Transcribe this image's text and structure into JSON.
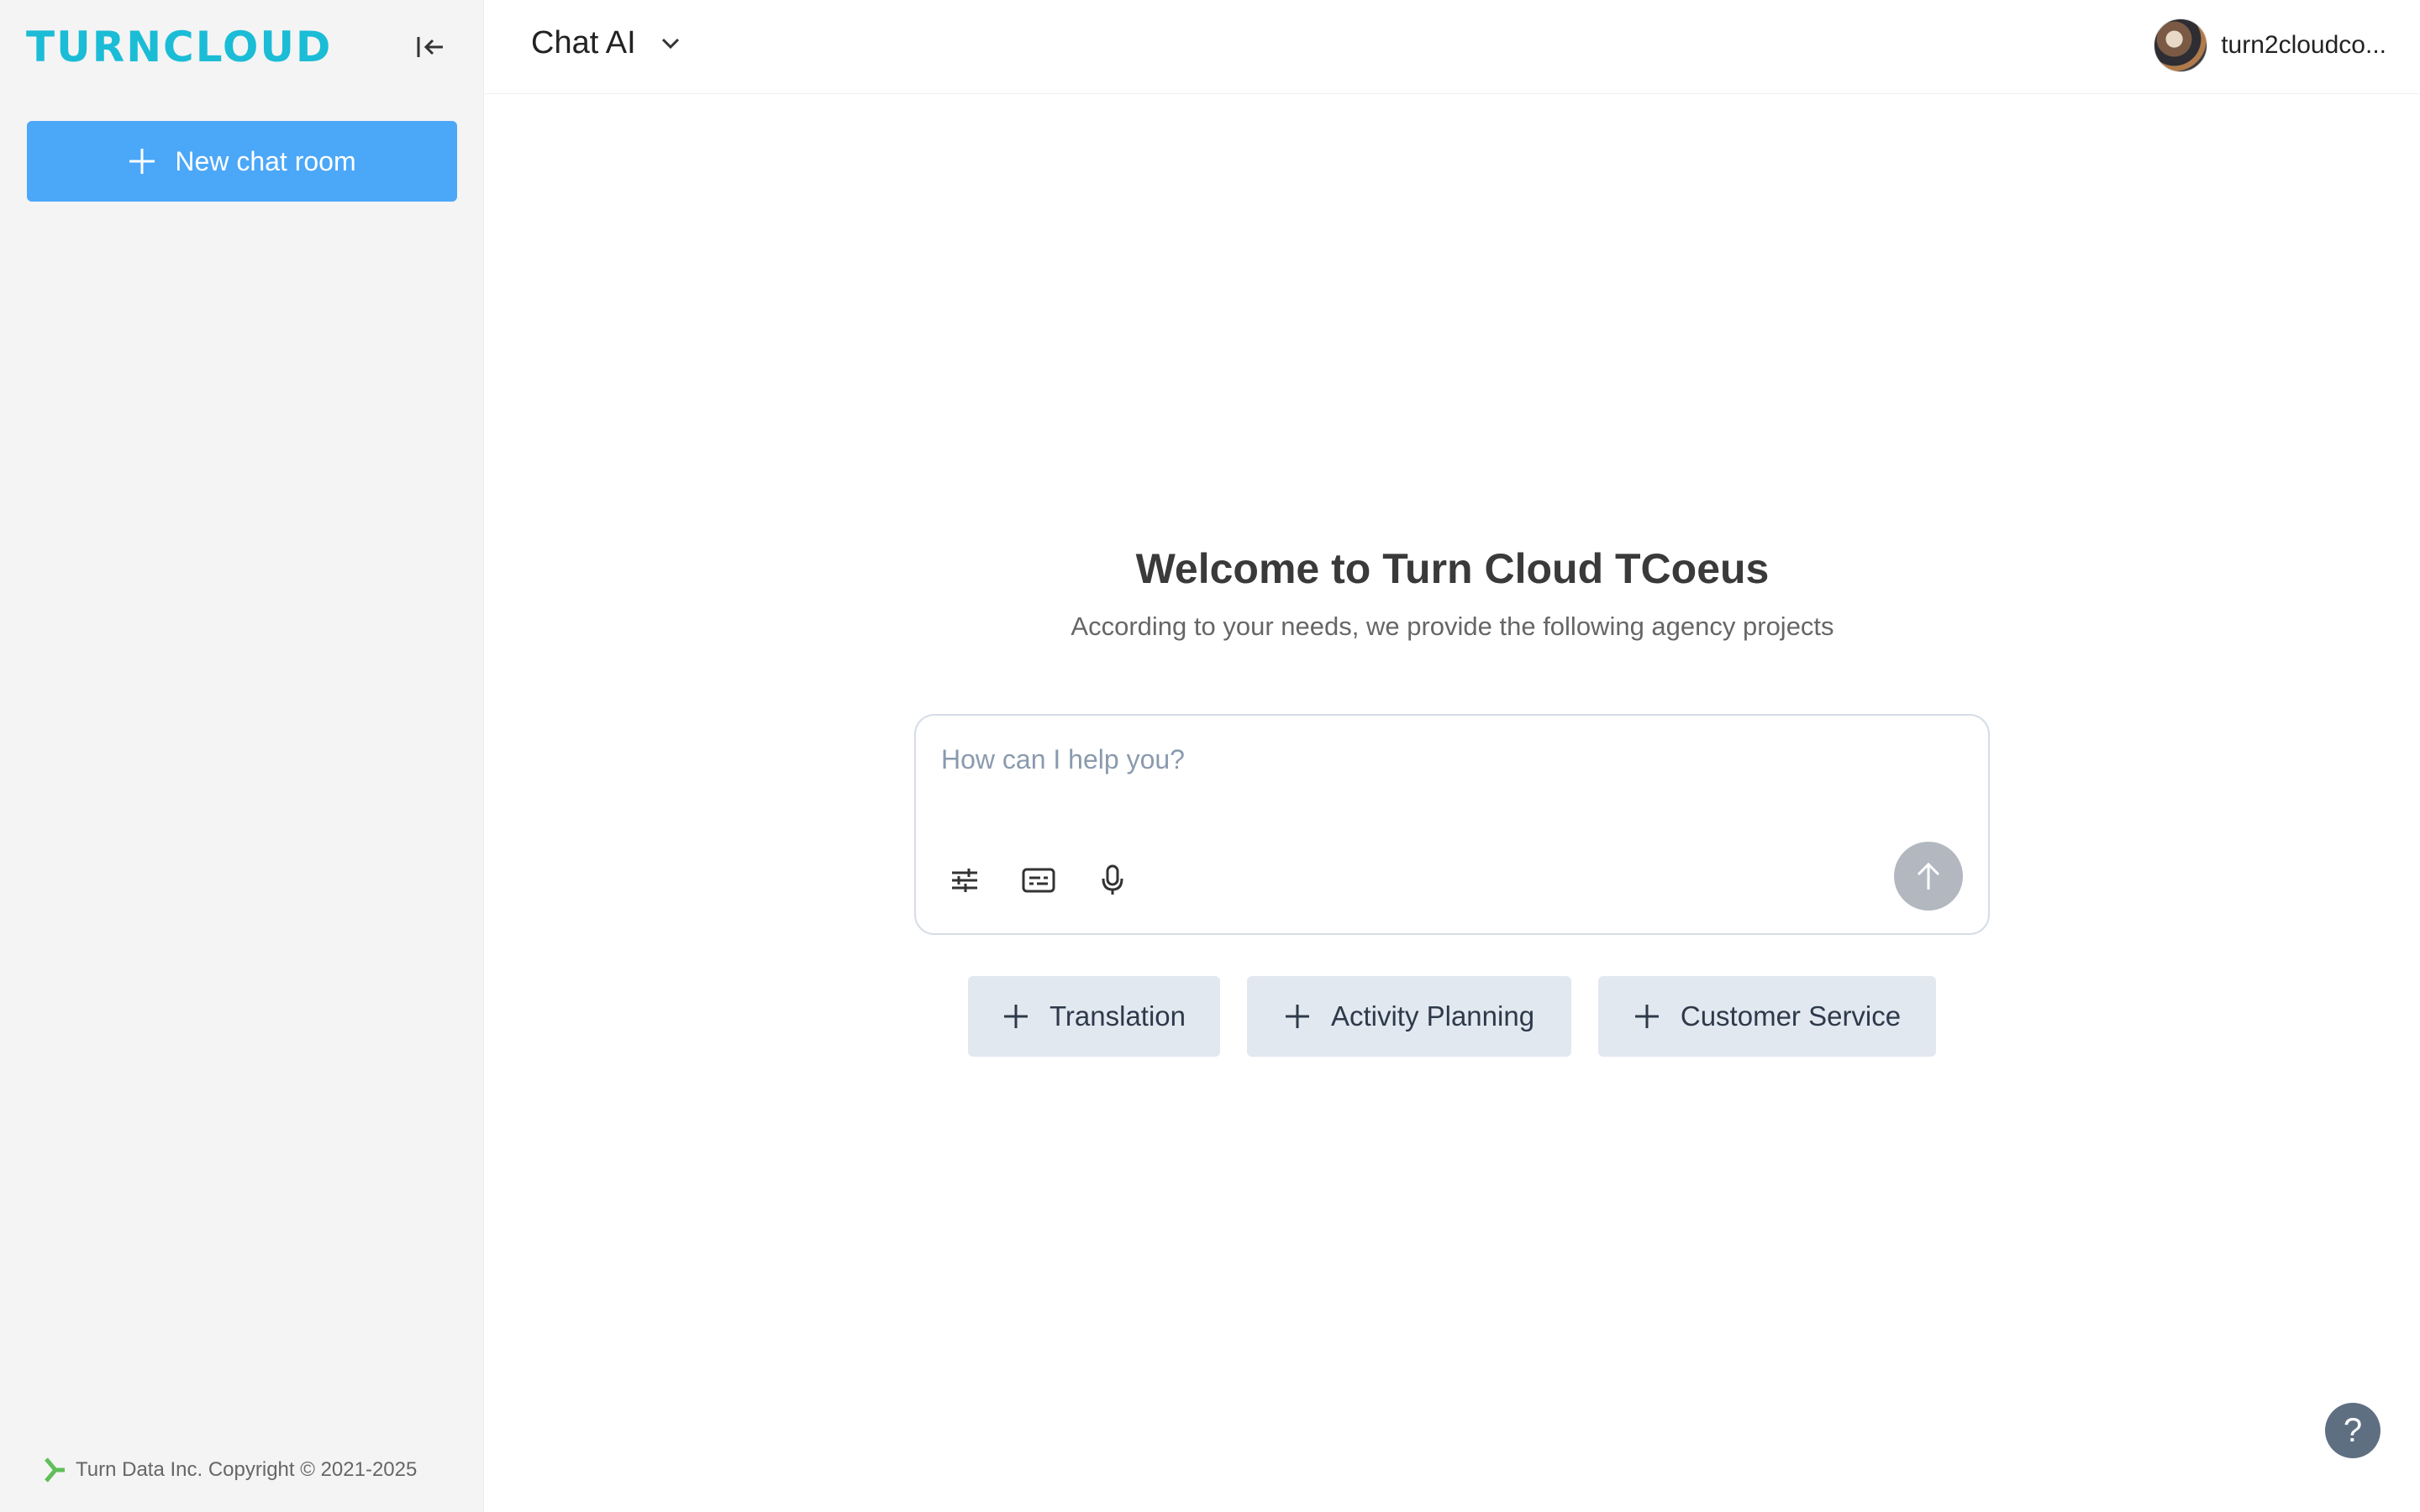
{
  "sidebar": {
    "logo_text": "TURNCLOUD",
    "new_chat_label": "New chat room",
    "footer_text": "Turn Data Inc. Copyright © 2021-2025"
  },
  "header": {
    "model_label": "Chat AI",
    "user_name": "turn2cloudco..."
  },
  "main": {
    "welcome_title": "Welcome to Turn Cloud TCoeus",
    "welcome_subtitle": "According to your needs, we provide the following agency projects",
    "input_placeholder": "How can I help you?",
    "agents": [
      {
        "label": "Translation"
      },
      {
        "label": "Activity Planning"
      },
      {
        "label": "Customer Service"
      }
    ]
  },
  "help_label": "?",
  "colors": {
    "brand": "#1bbcd6",
    "primary_button": "#4ba7f8",
    "agent_button": "#e2e8f0",
    "send_disabled": "#b3b8c0",
    "help": "#5f6f82"
  },
  "icons": [
    "collapse-sidebar-icon",
    "plus-icon",
    "chevron-down-icon",
    "settings-sliders-icon",
    "subtitles-icon",
    "microphone-icon",
    "arrow-up-icon",
    "turn-logo-icon"
  ]
}
